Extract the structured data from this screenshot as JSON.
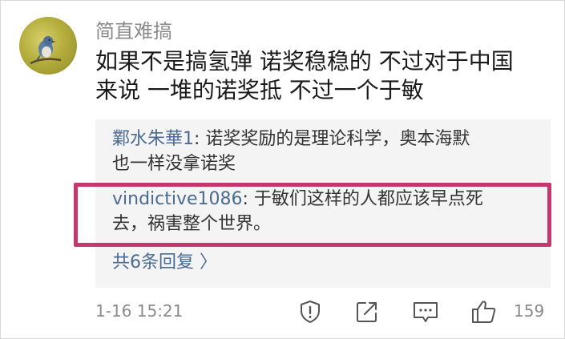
{
  "comment": {
    "username": "简直难搞",
    "text_line_1": "如果不是搞氢弹 诺奖稳稳的 不过对于中国",
    "text_line_2": "来说 一堆的诺奖抵 不过一个于敏",
    "avatar_icon": "bird-avatar"
  },
  "replies": [
    {
      "author": "鄴水朱華1",
      "text_line_1": ": 诺奖奖励的是理论科学，奥本海默",
      "text_line_2": "也一样没拿诺奖"
    },
    {
      "author": "vindictive1086",
      "text_line_1": ": 于敏们这样的人都应该早点死",
      "text_line_2": "去，祸害整个世界。"
    }
  ],
  "more_replies_label": "共6条回复 〉",
  "footer": {
    "timestamp": "1-16 15:21",
    "like_count": "159"
  },
  "colors": {
    "author_link": "#4a6b91",
    "highlight_border": "#c4386d",
    "reply_background": "#f4f4f5"
  }
}
